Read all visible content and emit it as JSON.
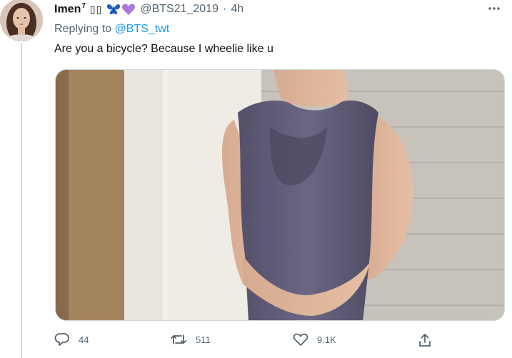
{
  "tweet": {
    "author_name": "Imen",
    "author_superscript": "7",
    "unknown_glyphs": "▯▯",
    "handle": "@BTS21_2019",
    "separator": "·",
    "time": "4h",
    "replying_prefix": "Replying to",
    "replying_to": "@BTS_twt",
    "text": "Are you a bicycle? Because I wheelie like u"
  },
  "actions": {
    "replies": "44",
    "retweets": "511",
    "likes": "9.1K"
  },
  "colors": {
    "link": "#1d9bf0",
    "muted": "#536471",
    "butterfly": "#1f5fbf",
    "purple_heart": "#a97ad9"
  },
  "icons": [
    "more-options-icon",
    "butterfly-emoji-icon",
    "purple-heart-emoji-icon",
    "reply-icon",
    "retweet-icon",
    "like-icon",
    "share-icon"
  ]
}
